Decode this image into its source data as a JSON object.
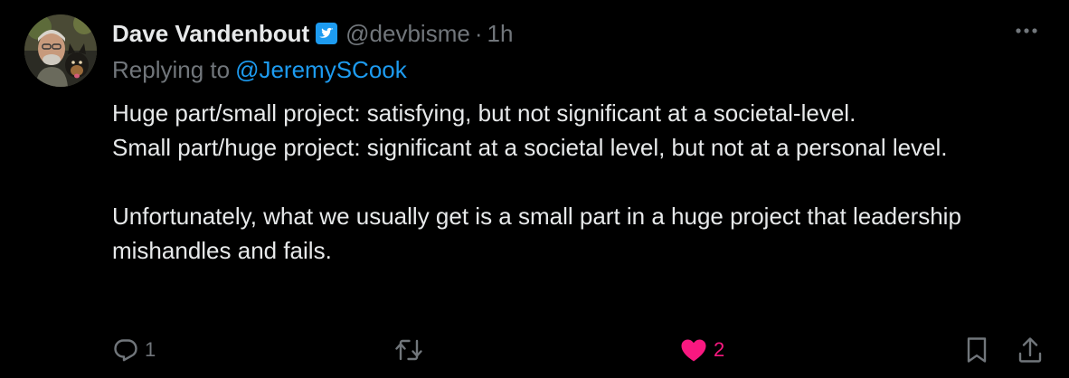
{
  "tweet": {
    "author": {
      "display_name": "Dave Vandenbout",
      "handle": "@devbisme",
      "verified": true
    },
    "separator": "·",
    "time": "1h",
    "replying_to": {
      "prefix": "Replying to",
      "mention": "@JeremySCook"
    },
    "body": {
      "line1": "Huge part/small project: satisfying, but not significant at a societal-level.",
      "line2": "Small part/huge project: significant at a societal level, but not at a personal level.",
      "paragraph2": "Unfortunately, what we usually get is a small part in a huge project that leadership mishandles and fails."
    },
    "actions": {
      "reply_count": "1",
      "like_count": "2"
    }
  },
  "colors": {
    "background": "#000000",
    "text": "#e7e9ea",
    "secondary": "#71767b",
    "mention": "#1d9bf0",
    "verified": "#1d9bf0",
    "like": "#f91880"
  },
  "icons": [
    "avatar",
    "verified-badge-icon",
    "more-icon",
    "reply-icon",
    "retweet-icon",
    "like-icon",
    "bookmark-icon",
    "share-icon"
  ]
}
